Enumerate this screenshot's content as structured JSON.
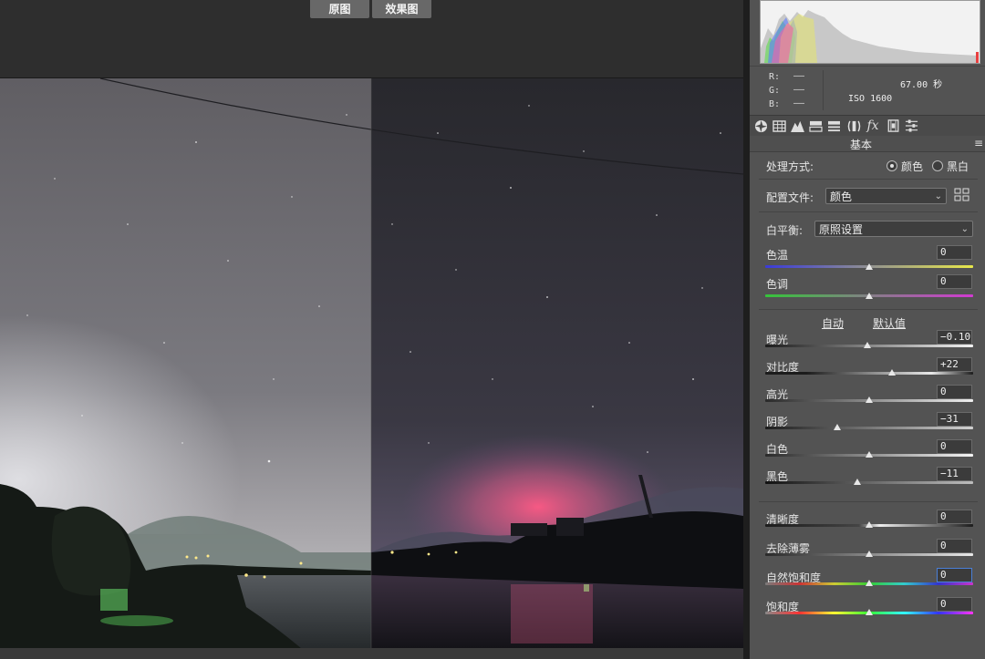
{
  "viewer": {
    "tab_before": "原图",
    "tab_after": "效果图"
  },
  "histogram": {
    "r_label": "R:",
    "g_label": "G:",
    "b_label": "B:",
    "r_value": "——",
    "g_value": "——",
    "b_value": "——",
    "shutter": "67.00 秒",
    "iso": "ISO 1600"
  },
  "tools": [
    "aperture-icon",
    "grid-table-icon",
    "mountain-icon",
    "split-tone-icon",
    "detail-bars-icon",
    "lens-icon",
    "fx-icon",
    "filmstrip-icon",
    "sliders-icon"
  ],
  "section": {
    "title": "基本"
  },
  "treatment": {
    "label": "处理方式:",
    "color_option": "颜色",
    "bw_option": "黑白",
    "selected": "颜色"
  },
  "profile": {
    "label": "配置文件:",
    "value": "颜色"
  },
  "white_balance": {
    "label": "白平衡:",
    "value": "原照设置"
  },
  "temp": {
    "label": "色温",
    "value": "0",
    "level": 0.5
  },
  "tint": {
    "label": "色调",
    "value": "0",
    "level": 0.5
  },
  "auto_links": {
    "auto": "自动",
    "default": "默认值"
  },
  "tone": [
    {
      "label": "曝光",
      "value": "−0.10",
      "level": 0.49
    },
    {
      "label": "对比度",
      "value": "+22",
      "level": 0.61
    },
    {
      "label": "高光",
      "value": "0",
      "level": 0.5
    },
    {
      "label": "阴影",
      "value": "−31",
      "level": 0.345
    },
    {
      "label": "白色",
      "value": "0",
      "level": 0.5
    },
    {
      "label": "黑色",
      "value": "−11",
      "level": 0.445
    }
  ],
  "presence": [
    {
      "label": "清晰度",
      "value": "0",
      "level": 0.5
    },
    {
      "label": "去除薄雾",
      "value": "0",
      "level": 0.5
    },
    {
      "label": "自然饱和度",
      "value": "0",
      "level": 0.5
    },
    {
      "label": "饱和度",
      "value": "0",
      "level": 0.5
    }
  ],
  "colors": {
    "panel_bg": "#535353",
    "accent_focus": "#4a7fd6"
  }
}
